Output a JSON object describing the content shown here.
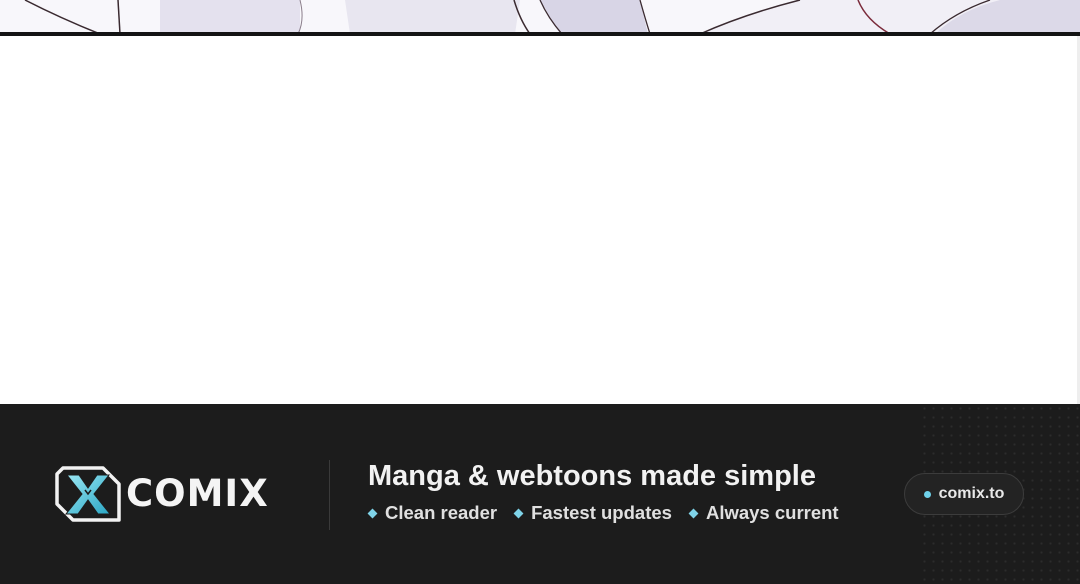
{
  "banner": {
    "brand_name": "COMIX",
    "logo_icon": "x-logo-icon",
    "tagline": "Manga & webtoons made simple",
    "features": [
      {
        "label": "Clean reader",
        "icon": "diamond-bullet-icon"
      },
      {
        "label": "Fastest updates",
        "icon": "diamond-bullet-icon"
      },
      {
        "label": "Always current",
        "icon": "diamond-bullet-icon"
      }
    ],
    "url": "comix.to",
    "url_dot_icon": "dot-icon"
  },
  "colors": {
    "banner_background": "#1c1c1c",
    "accent": "#7fd3e8",
    "text": "#f2f2f2",
    "panel_border": "#141414"
  }
}
